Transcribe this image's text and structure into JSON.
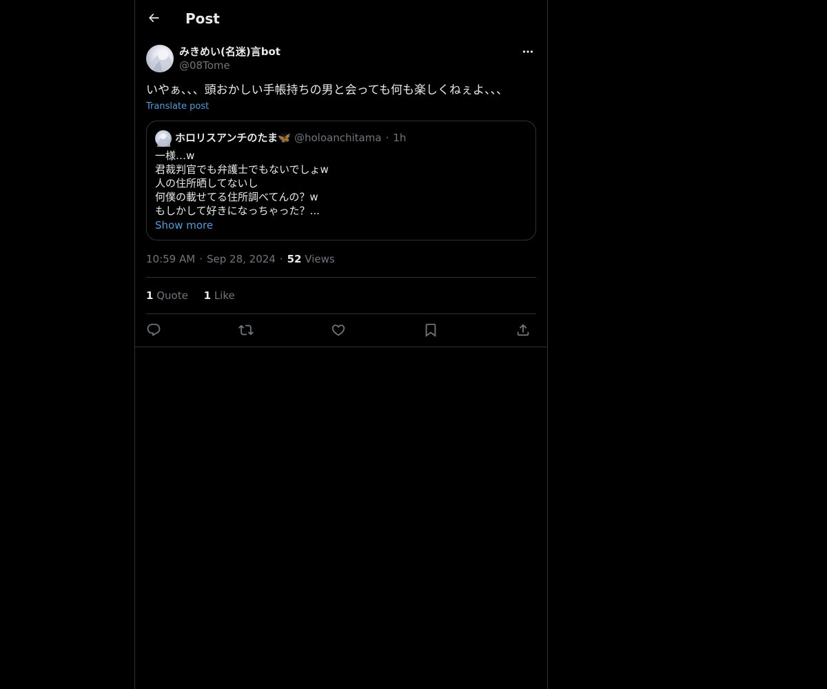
{
  "header": {
    "title": "Post",
    "back_icon": "arrow-left-icon"
  },
  "post": {
    "author": {
      "display_name": "みきめい(名迷)言bot",
      "handle": "@08Tome"
    },
    "text": "いやぁ、、、頭おかしい手帳持ちの男と会っても何も楽しくねぇよ、、、",
    "translate_label": "Translate post",
    "quoted": {
      "display_name": "ホロリスアンチのたま",
      "name_emoji": "🦋",
      "handle": "@holoanchitama",
      "separator": "·",
      "time": "1h",
      "lines": [
        "一様…w",
        "君裁判官でも弁護士でもないでしょw",
        "人の住所晒してないし",
        "何僕の載せてる住所調べてんの？w",
        "もしかして好きになっちゃった？..."
      ],
      "show_more_label": "Show more"
    },
    "meta": {
      "time": "10:59 AM",
      "separator": "·",
      "date": "Sep 28, 2024",
      "views_count": "52",
      "views_label": "Views"
    },
    "stats": {
      "quotes_count": "1",
      "quotes_label": "Quote",
      "likes_count": "1",
      "likes_label": "Like"
    },
    "actions": [
      "reply-icon",
      "repost-icon",
      "like-icon",
      "bookmark-icon",
      "share-icon"
    ]
  },
  "colors": {
    "background": "#000000",
    "text_primary": "#e7e9ea",
    "text_secondary": "#71767b",
    "link": "#5b9bd5",
    "border": "#2f3336"
  }
}
